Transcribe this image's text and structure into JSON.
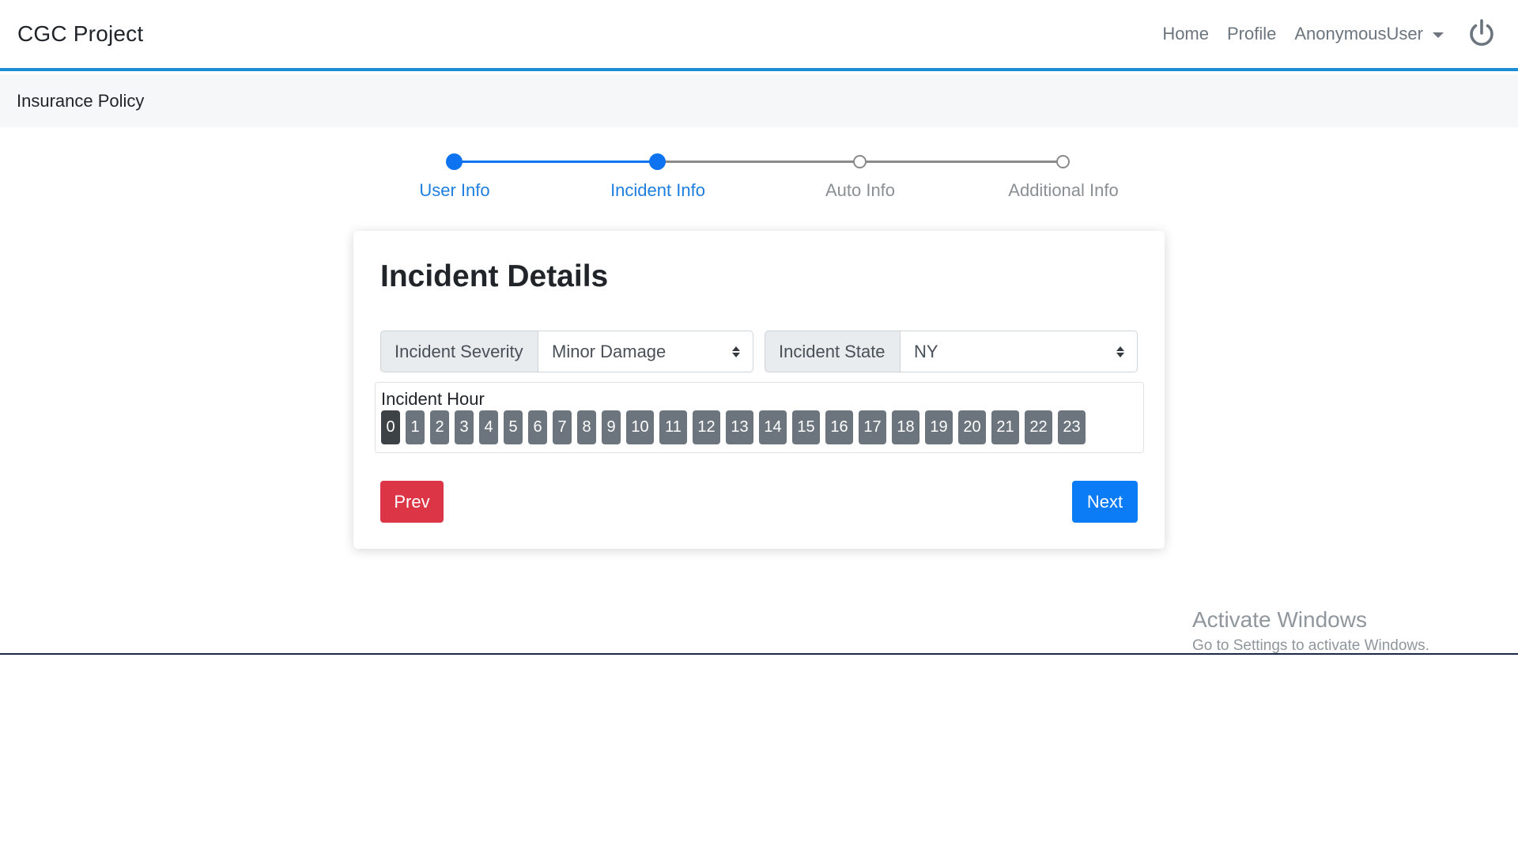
{
  "navbar": {
    "brand": "CGC Project",
    "links": [
      "Home",
      "Profile"
    ],
    "user": "AnonymousUser",
    "power_icon": "power-icon",
    "accent_color": "#1a8bd6"
  },
  "subbar": {
    "title": "Insurance Policy"
  },
  "stepper": {
    "steps": [
      {
        "label": "User Info",
        "state": "active"
      },
      {
        "label": "Incident Info",
        "state": "active"
      },
      {
        "label": "Auto Info",
        "state": "inactive"
      },
      {
        "label": "Additional Info",
        "state": "inactive"
      }
    ],
    "active_color": "#0d73f0"
  },
  "form": {
    "title": "Incident Details",
    "severity": {
      "label": "Incident Severity",
      "value": "Minor Damage"
    },
    "state": {
      "label": "Incident State",
      "value": "NY"
    },
    "hour": {
      "label": "Incident Hour",
      "options": [
        "0",
        "1",
        "2",
        "3",
        "4",
        "5",
        "6",
        "7",
        "8",
        "9",
        "10",
        "11",
        "12",
        "13",
        "14",
        "15",
        "16",
        "17",
        "18",
        "19",
        "20",
        "21",
        "22",
        "23"
      ],
      "selected": "0"
    },
    "prev_label": "Prev",
    "next_label": "Next"
  },
  "watermark": {
    "title": "Activate Windows",
    "subtitle": "Go to Settings to activate Windows."
  }
}
